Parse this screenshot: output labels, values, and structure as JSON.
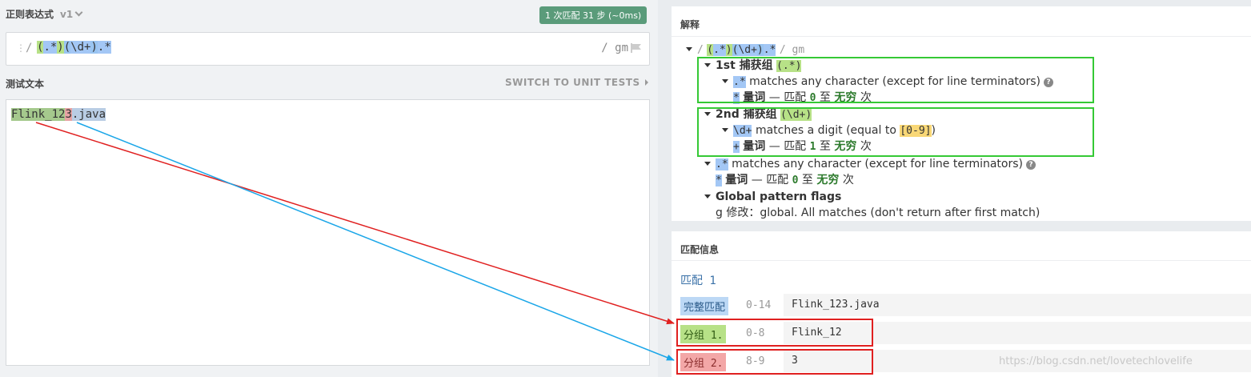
{
  "regex": {
    "header": "正则表达式",
    "version": "v1",
    "badge": "1 次匹配 31 步 (~0ms)",
    "slash_left": "/",
    "flags": "/ gm",
    "tokens": [
      "(",
      ".*",
      ")",
      "(",
      "\\d+",
      ")",
      ".*"
    ]
  },
  "test": {
    "header": "测试文本",
    "switch_label": "SWITCH TO UNIT TESTS",
    "text_g1": "Flink_12",
    "text_g2": "3",
    "text_rest": ".java"
  },
  "explanation": {
    "title": "解释",
    "root_slash": "/",
    "root_flags": "/ gm",
    "group1_title": "1st 捕获组",
    "group1_token": "(.*)",
    "dotstar": ".*",
    "any_char": "matches any character (except for line terminators)",
    "star": "*",
    "quant_word": "量词",
    "dash": "—",
    "match_word": "匹配",
    "zero": "0",
    "one": "1",
    "to_word": "至",
    "infinite": "无穷",
    "times": "次",
    "group2_title": "2nd 捕获组",
    "group2_token": "(\\d+)",
    "digit_token": "\\d+",
    "digit_desc_a": "matches a digit (equal to",
    "digit_class": "[0-9]",
    "digit_desc_b": ")",
    "plus": "+",
    "flags_title": "Global pattern flags",
    "flag_g_line": "g 修改：global. All matches (don't return after first match)"
  },
  "match_info": {
    "title": "匹配信息",
    "match_label": "匹配 1",
    "rows": [
      {
        "label": "完整匹配",
        "range": "0-14",
        "value": "Flink_123.java"
      },
      {
        "label": "分组 1.",
        "range": "0-8",
        "value": "Flink_12"
      },
      {
        "label": "分组 2.",
        "range": "8-9",
        "value": "3"
      }
    ]
  },
  "watermark": "https://blog.csdn.net/lovetechlovelife",
  "colors": {
    "group1": "#b7e187",
    "group2": "#99c4f1",
    "annot_red": "#e02020",
    "annot_blue": "#1aa6e8",
    "annot_green": "#35c935"
  }
}
